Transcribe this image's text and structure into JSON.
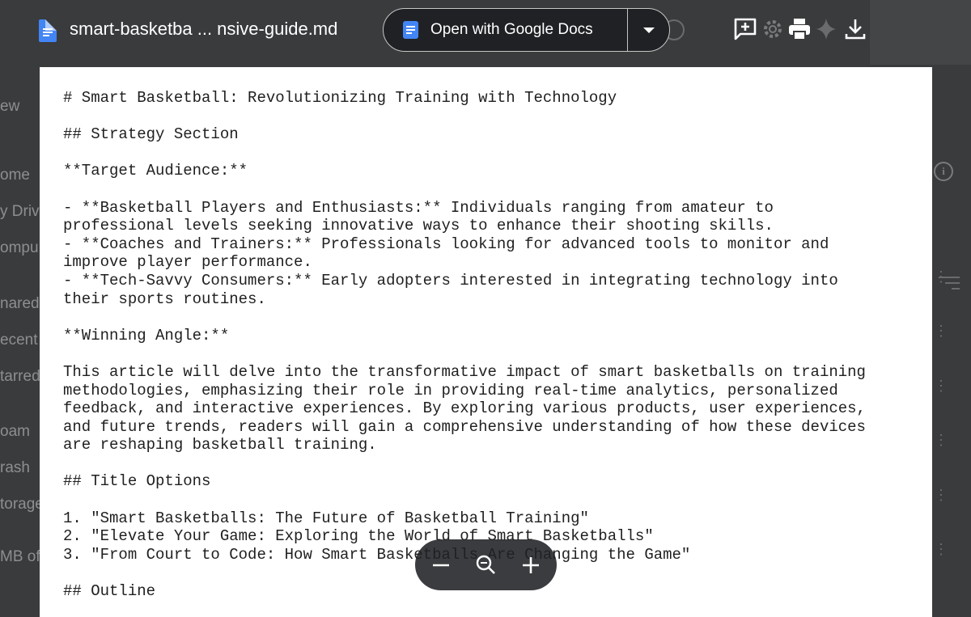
{
  "viewer": {
    "file_name": "smart-basketba ... nsive-guide.md",
    "open_with_label": "Open with Google Docs"
  },
  "background": {
    "sidebar_items": [
      "ew",
      "ome",
      "y Driv",
      "ompu",
      "nared",
      "ecent",
      "tarred",
      "oam",
      "rash",
      "torage",
      "MB of"
    ]
  },
  "document": {
    "lines": [
      "# Smart Basketball: Revolutionizing Training with Technology",
      "",
      "## Strategy Section",
      "",
      "**Target Audience:**",
      "",
      "- **Basketball Players and Enthusiasts:** Individuals ranging from amateur to",
      "professional levels seeking innovative ways to enhance their shooting skills.",
      "- **Coaches and Trainers:** Professionals looking for advanced tools to monitor and",
      "improve player performance.",
      "- **Tech-Savvy Consumers:** Early adopters interested in integrating technology into",
      "their sports routines.",
      "",
      "**Winning Angle:**",
      "",
      "This article will delve into the transformative impact of smart basketballs on training",
      "methodologies, emphasizing their role in providing real-time analytics, personalized",
      "feedback, and interactive experiences. By exploring various products, user experiences,",
      "and future trends, readers will gain a comprehensive understanding of how these devices",
      "are reshaping basketball training.",
      "",
      "## Title Options",
      "",
      "1. \"Smart Basketballs: The Future of Basketball Training\"",
      "2. \"Elevate Your Game: Exploring the World of Smart Basketballs\"",
      "3. \"From Court to Code: How Smart Basketballs Are Changing the Game\"",
      "",
      "## Outline"
    ]
  },
  "icons": {
    "file": "docs-file-icon",
    "docs": "google-docs-icon",
    "caret": "chevron-down-icon",
    "comment": "add-comment-icon",
    "settings": "gear-icon",
    "print": "printer-icon",
    "gemini": "sparkle-icon",
    "download": "download-icon",
    "zoom_out": "minus-icon",
    "zoom_reset": "magnifier-icon",
    "zoom_in": "plus-icon"
  },
  "colors": {
    "background": "#3a3b3d",
    "docs_blue": "#4285f4",
    "page": "#ffffff",
    "text": "#1f1f1f"
  }
}
